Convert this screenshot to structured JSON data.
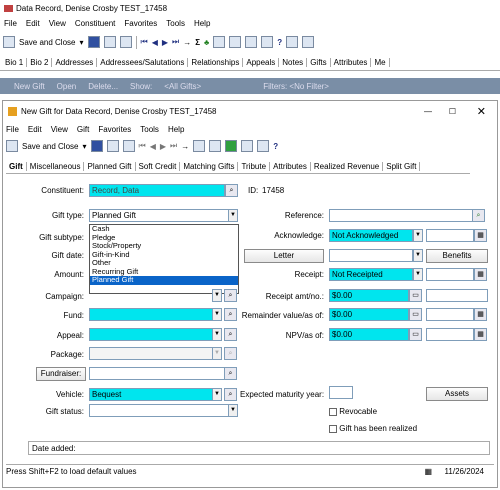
{
  "outer": {
    "title": "Data Record, Denise Crosby TEST_17458",
    "menu": [
      "File",
      "Edit",
      "View",
      "Constituent",
      "Favorites",
      "Tools",
      "Help"
    ],
    "save_close": "Save and Close",
    "tabs": [
      "Bio 1",
      "Bio 2",
      "Addresses",
      "Addressees/Salutations",
      "Relationships",
      "Appeals",
      "Notes",
      "Gifts",
      "Attributes",
      "Me"
    ],
    "gift_toolbar": {
      "new": "New Gift",
      "open": "Open",
      "delete": "Delete...",
      "show_label": "Show:",
      "show_value": "<All Gifts>",
      "filters": "Filters: <No Filter>"
    }
  },
  "inner": {
    "title": "New Gift for Data Record, Denise Crosby TEST_17458",
    "menu": [
      "File",
      "Edit",
      "View",
      "Gift",
      "Favorites",
      "Tools",
      "Help"
    ],
    "save_close": "Save and Close",
    "tabs": [
      "Gift",
      "Miscellaneous",
      "Planned Gift",
      "Soft Credit",
      "Matching Gifts",
      "Tribute",
      "Attributes",
      "Realized Revenue",
      "Split Gift"
    ]
  },
  "form": {
    "constituent_label": "Constituent:",
    "constituent_value": "Record, Data",
    "id_label": "ID:",
    "id_value": "17458",
    "gift_type_label": "Gift type:",
    "gift_type_value": "Planned Gift",
    "gift_type_options": [
      "Cash",
      "Pledge",
      "Stock/Property",
      "Gift-in-Kind",
      "Other",
      "Recurring Gift",
      "Planned Gift"
    ],
    "gift_subtype_label": "Gift subtype:",
    "gift_date_label": "Gift date:",
    "amount_label": "Amount:",
    "campaign_label": "Campaign:",
    "fund_label": "Fund:",
    "appeal_label": "Appeal:",
    "package_label": "Package:",
    "fundraiser_button": "Fundraiser:",
    "vehicle_label": "Vehicle:",
    "vehicle_value": "Bequest",
    "gift_status_label": "Gift status:",
    "reference_label": "Reference:",
    "acknowledge_label": "Acknowledge:",
    "acknowledge_value": "Not Acknowledged",
    "letter_button": "Letter",
    "benefits_button": "Benefits",
    "receipt_label": "Receipt:",
    "receipt_value": "Not Receipted",
    "receipt_amt_label": "Receipt amt/no.:",
    "receipt_amt_value": "$0.00",
    "remainder_label": "Remainder value/as of:",
    "remainder_value": "$0.00",
    "npv_label": "NPV/as of:",
    "npv_value": "$0.00",
    "maturity_label": "Expected maturity year:",
    "assets_button": "Assets",
    "revocable_label": "Revocable",
    "realized_label": "Gift has been realized",
    "date_added_label": "Date added:"
  },
  "status": {
    "hint": "Press Shift+F2 to load default values",
    "date": "11/26/2024"
  }
}
